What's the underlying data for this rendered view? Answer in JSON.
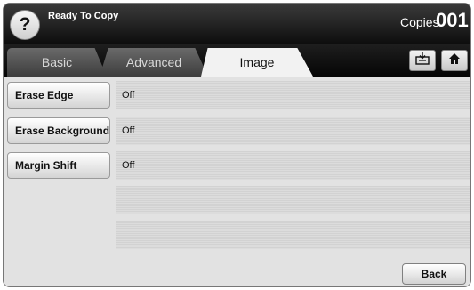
{
  "header": {
    "help_label": "?",
    "status": "Ready To Copy",
    "copies_label": "Copies",
    "copies_count": "001"
  },
  "tabs": [
    {
      "label": "Basic",
      "active": false
    },
    {
      "label": "Advanced",
      "active": false
    },
    {
      "label": "Image",
      "active": true
    }
  ],
  "toolbar_icons": [
    "job-status-icon",
    "home-icon"
  ],
  "options": [
    {
      "label": "Erase Edge",
      "value": "Off"
    },
    {
      "label": "Erase Background",
      "value": "Off"
    },
    {
      "label": "Margin Shift",
      "value": "Off"
    }
  ],
  "footer": {
    "back_label": "Back"
  }
}
